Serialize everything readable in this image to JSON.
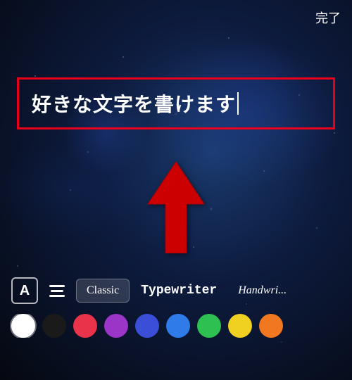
{
  "header": {
    "done_label": "完了"
  },
  "text_input": {
    "value": "好きな文字を書けます"
  },
  "toolbar": {
    "font_icon_label": "A",
    "fonts": [
      {
        "id": "classic",
        "label": "Classic",
        "selected": false
      },
      {
        "id": "typewriter",
        "label": "Typewriter",
        "selected": true
      },
      {
        "id": "handwriting",
        "label": "Handwri...",
        "selected": false
      }
    ],
    "colors": [
      {
        "id": "white",
        "hex": "#ffffff",
        "selected": true
      },
      {
        "id": "black",
        "hex": "#1a1a1a",
        "selected": false
      },
      {
        "id": "red",
        "hex": "#e8334a",
        "selected": false
      },
      {
        "id": "purple",
        "hex": "#9b35c8",
        "selected": false
      },
      {
        "id": "dark-blue",
        "hex": "#3b4ed8",
        "selected": false
      },
      {
        "id": "blue",
        "hex": "#2f7be8",
        "selected": false
      },
      {
        "id": "green",
        "hex": "#2ec050",
        "selected": false
      },
      {
        "id": "yellow",
        "hex": "#f0d020",
        "selected": false
      },
      {
        "id": "orange",
        "hex": "#f07820",
        "selected": false
      }
    ]
  }
}
